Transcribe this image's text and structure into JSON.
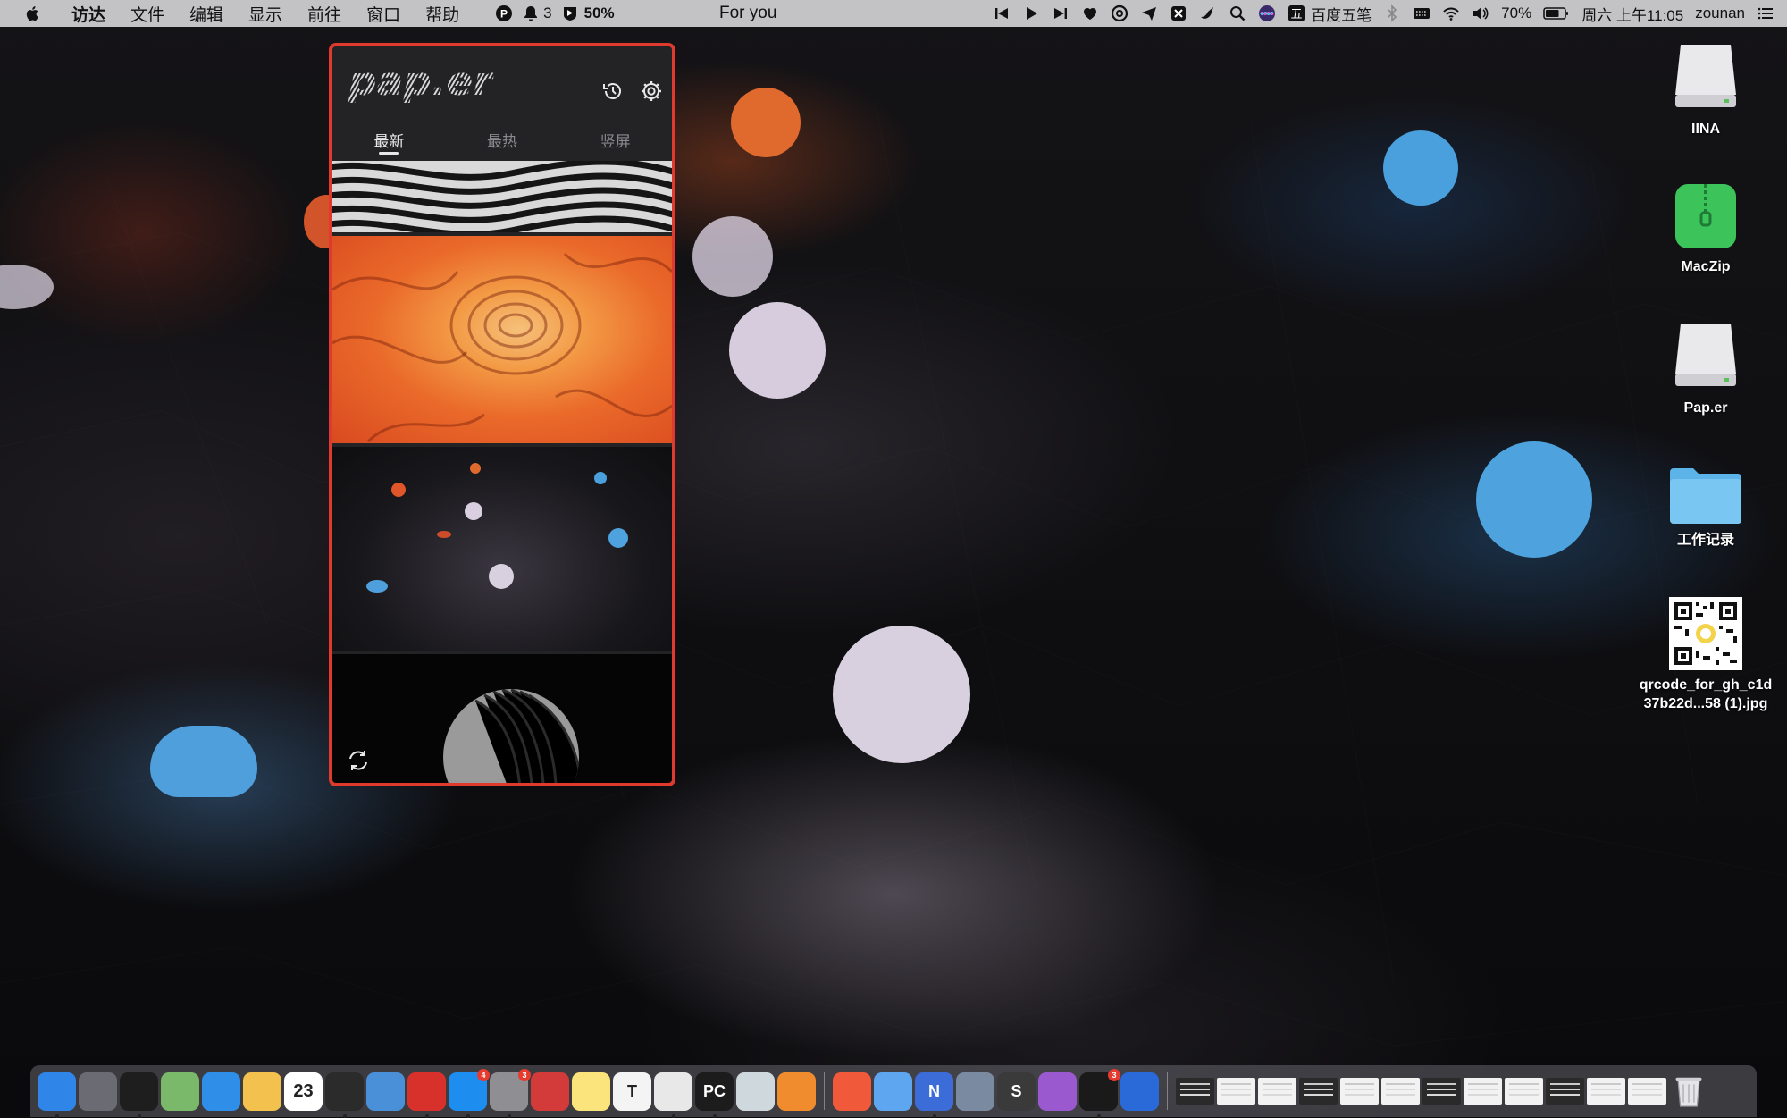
{
  "menubar": {
    "app_menus": [
      "访达",
      "文件",
      "编辑",
      "显示",
      "前往",
      "窗口",
      "帮助"
    ],
    "notification_count": "3",
    "percent_badge": "50%",
    "now_playing": "For you",
    "input_method": "百度五笔",
    "battery": "70%",
    "clock": "周六 上午11:05",
    "user": "zounan",
    "icons": [
      "apple-icon",
      "p-icon",
      "bell-icon",
      "shield-icon",
      "prev-track-icon",
      "play-icon",
      "next-track-icon",
      "heart-icon",
      "netease-icon",
      "send-icon",
      "reeder-icon",
      "bird-icon",
      "search-icon",
      "siri-icon",
      "bluetooth-icon",
      "keyboard-icon",
      "wifi-icon",
      "volume-icon",
      "battery-icon",
      "control-center-icon"
    ]
  },
  "panel": {
    "logo": "pap.er",
    "tabs": [
      {
        "label": "最新",
        "active": true
      },
      {
        "label": "最热",
        "active": false
      },
      {
        "label": "竖屏",
        "active": false
      }
    ],
    "header_icons": [
      "history-icon",
      "settings-icon"
    ],
    "footer_icon": "refresh-icon",
    "accent": "#e03a2e",
    "thumbnails": [
      "zebra-stripes",
      "orange-paper-waves",
      "dark-lowpoly-orbs",
      "striped-sphere"
    ]
  },
  "desktop": {
    "icons": [
      {
        "label": "IINA",
        "kind": "drive"
      },
      {
        "label": "MacZip",
        "kind": "zip"
      },
      {
        "label": "Pap.er",
        "kind": "drive"
      },
      {
        "label": "工作记录",
        "kind": "folder"
      },
      {
        "label": "qrcode_for_gh_c1d\n37b22d...58 (1).jpg",
        "kind": "qrcode"
      }
    ]
  },
  "dock": {
    "apps": [
      {
        "name": "finder",
        "color": "#2f86e8"
      },
      {
        "name": "launchpad",
        "color": "#6b6b74"
      },
      {
        "name": "terminal-dark",
        "color": "#1e1e1e"
      },
      {
        "name": "maps",
        "color": "#7ab86a"
      },
      {
        "name": "safari",
        "color": "#2f8fe8"
      },
      {
        "name": "photos",
        "color": "#f2c14e"
      },
      {
        "name": "calendar",
        "color": "#ffffff",
        "text": "23"
      },
      {
        "name": "terminal",
        "color": "#2b2b2b"
      },
      {
        "name": "screen-sharing",
        "color": "#4a90d9"
      },
      {
        "name": "netease-music",
        "color": "#d8312c"
      },
      {
        "name": "app-store",
        "color": "#1d8ef0",
        "badge": "4"
      },
      {
        "name": "system-preferences",
        "color": "#8e8e93",
        "badge": "3"
      },
      {
        "name": "parallels",
        "color": "#d33b3b"
      },
      {
        "name": "notes",
        "color": "#fbe47b"
      },
      {
        "name": "typora",
        "color": "#f4f4f4",
        "text": "T"
      },
      {
        "name": "chrome",
        "color": "#e8e8e8"
      },
      {
        "name": "pycharm",
        "color": "#1c1c1c",
        "text": "PC"
      },
      {
        "name": "preview-eye",
        "color": "#cfd8dc"
      },
      {
        "name": "paw",
        "color": "#f08c2e"
      },
      {
        "name": "pdf-expert",
        "color": "#f05a3a"
      },
      {
        "name": "mail-bird",
        "color": "#5fa6f0"
      },
      {
        "name": "nimbus",
        "color": "#3b6cd8",
        "text": "N"
      },
      {
        "name": "image-viewer",
        "color": "#7a8aa0"
      },
      {
        "name": "sublime",
        "color": "#3a3a3a",
        "text": "S"
      },
      {
        "name": "downie",
        "color": "#9b59d0"
      },
      {
        "name": "qq",
        "color": "#1a1a1a",
        "badge": "3"
      },
      {
        "name": "screen-recorder",
        "color": "#2a6ad8"
      }
    ],
    "docs_count": 12,
    "trash": "trash-icon"
  }
}
